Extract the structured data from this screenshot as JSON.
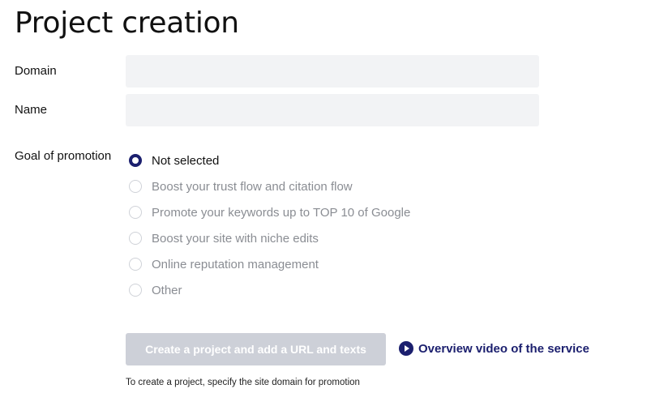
{
  "page": {
    "title": "Project creation"
  },
  "form": {
    "domain": {
      "label": "Domain",
      "value": "",
      "placeholder": ""
    },
    "name": {
      "label": "Name",
      "value": "",
      "placeholder": ""
    },
    "goal": {
      "label": "Goal of promotion",
      "options": [
        {
          "label": "Not selected",
          "selected": true
        },
        {
          "label": "Boost your trust flow and citation flow",
          "selected": false
        },
        {
          "label": "Promote your keywords up to TOP 10 of Google",
          "selected": false
        },
        {
          "label": "Boost your site with niche edits",
          "selected": false
        },
        {
          "label": "Online reputation management",
          "selected": false
        },
        {
          "label": "Other",
          "selected": false
        }
      ]
    }
  },
  "actions": {
    "create_label": "Create a project and add a URL and texts",
    "create_disabled": true,
    "video_link_label": "Overview video of the service",
    "hint": "To create a project, specify the site domain for promotion"
  },
  "colors": {
    "accent": "#1b1f6e",
    "input_bg": "#f2f3f5",
    "button_disabled": "#cdd0d8",
    "muted_text": "#8a8d93"
  },
  "icons": {
    "video": "play-circle-icon",
    "radio": "radio-icon"
  }
}
